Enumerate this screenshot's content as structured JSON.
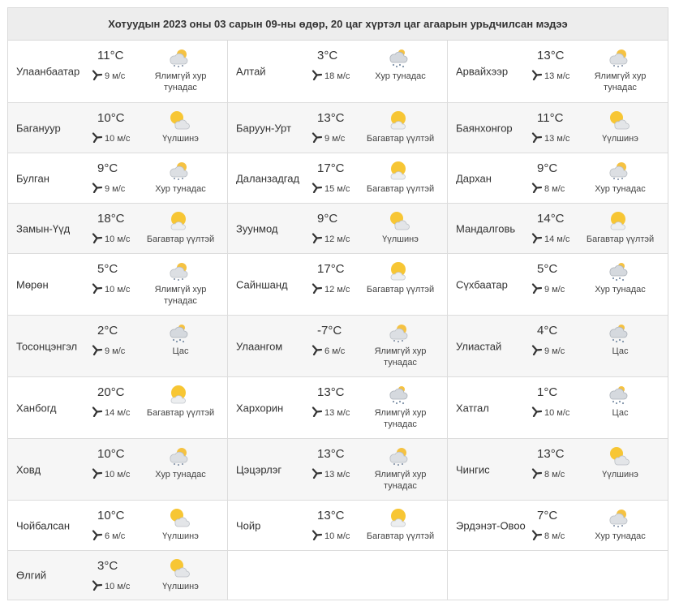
{
  "title": "Хотуудын 2023 оны 03 сарын 09-ны өдөр, 20 цаг хүртэл цаг агаарын урьдчилсан мэдээ",
  "unit": "°C",
  "rows": [
    [
      {
        "city": "Улаанбаатар",
        "temp": "11",
        "wind": "9 м/с",
        "desc": "Ялимгүй хур тунадас",
        "icon": "cloud-sun-snow-icon"
      },
      {
        "city": "Алтай",
        "temp": "3",
        "wind": "18 м/с",
        "desc": "Хур тунадас",
        "icon": "cloud-snow-icon"
      },
      {
        "city": "Арвайхээр",
        "temp": "13",
        "wind": "13 м/с",
        "desc": "Ялимгүй хур тунадас",
        "icon": "cloud-sun-snow-icon"
      }
    ],
    [
      {
        "city": "Багануур",
        "temp": "10",
        "wind": "10 м/с",
        "desc": "Үүлшинэ",
        "icon": "sun-cloud-icon"
      },
      {
        "city": "Баруун-Урт",
        "temp": "13",
        "wind": "9 м/с",
        "desc": "Багавтар үүлтэй",
        "icon": "sun-small-cloud-icon"
      },
      {
        "city": "Баянхонгор",
        "temp": "11",
        "wind": "13 м/с",
        "desc": "Үүлшинэ",
        "icon": "sun-cloud-icon"
      }
    ],
    [
      {
        "city": "Булган",
        "temp": "9",
        "wind": "9 м/с",
        "desc": "Хур тунадас",
        "icon": "cloud-sun-snow-icon"
      },
      {
        "city": "Даланзадгад",
        "temp": "17",
        "wind": "15 м/с",
        "desc": "Багавтар үүлтэй",
        "icon": "sun-small-cloud-icon"
      },
      {
        "city": "Дархан",
        "temp": "9",
        "wind": "8 м/с",
        "desc": "Хур тунадас",
        "icon": "cloud-sun-snow-icon"
      }
    ],
    [
      {
        "city": "Замын-Үүд",
        "temp": "18",
        "wind": "10 м/с",
        "desc": "Багавтар үүлтэй",
        "icon": "sun-small-cloud-icon"
      },
      {
        "city": "Зуунмод",
        "temp": "9",
        "wind": "12 м/с",
        "desc": "Үүлшинэ",
        "icon": "sun-cloud-icon"
      },
      {
        "city": "Мандалговь",
        "temp": "14",
        "wind": "14 м/с",
        "desc": "Багавтар үүлтэй",
        "icon": "sun-small-cloud-icon"
      }
    ],
    [
      {
        "city": "Мөрөн",
        "temp": "5",
        "wind": "10 м/с",
        "desc": "Ялимгүй хур тунадас",
        "icon": "cloud-sun-snow-icon"
      },
      {
        "city": "Сайншанд",
        "temp": "17",
        "wind": "12 м/с",
        "desc": "Багавтар үүлтэй",
        "icon": "sun-small-cloud-icon"
      },
      {
        "city": "Сүхбаатар",
        "temp": "5",
        "wind": "9 м/с",
        "desc": "Хур тунадас",
        "icon": "cloud-snow-icon"
      }
    ],
    [
      {
        "city": "Тосонцэнгэл",
        "temp": "2",
        "wind": "9 м/с",
        "desc": "Цас",
        "icon": "cloud-snow-icon"
      },
      {
        "city": "Улаангом",
        "temp": "-7",
        "wind": "6 м/с",
        "desc": "Ялимгүй хур тунадас",
        "icon": "cloud-sun-snow-icon"
      },
      {
        "city": "Улиастай",
        "temp": "4",
        "wind": "9 м/с",
        "desc": "Цас",
        "icon": "cloud-snow-icon"
      }
    ],
    [
      {
        "city": "Ханбогд",
        "temp": "20",
        "wind": "14 м/с",
        "desc": "Багавтар үүлтэй",
        "icon": "sun-small-cloud-icon"
      },
      {
        "city": "Хархорин",
        "temp": "13",
        "wind": "13 м/с",
        "desc": "Ялимгүй хур тунадас",
        "icon": "cloud-snow-icon"
      },
      {
        "city": "Хатгал",
        "temp": "1",
        "wind": "10 м/с",
        "desc": "Цас",
        "icon": "cloud-snow-icon"
      }
    ],
    [
      {
        "city": "Ховд",
        "temp": "10",
        "wind": "10 м/с",
        "desc": "Хур тунадас",
        "icon": "cloud-sun-snow-icon"
      },
      {
        "city": "Цэцэрлэг",
        "temp": "13",
        "wind": "13 м/с",
        "desc": "Ялимгүй хур тунадас",
        "icon": "cloud-sun-snow-icon"
      },
      {
        "city": "Чингис",
        "temp": "13",
        "wind": "8 м/с",
        "desc": "Үүлшинэ",
        "icon": "sun-cloud-icon"
      }
    ],
    [
      {
        "city": "Чойбалсан",
        "temp": "10",
        "wind": "6 м/с",
        "desc": "Үүлшинэ",
        "icon": "sun-cloud-icon"
      },
      {
        "city": "Чойр",
        "temp": "13",
        "wind": "10 м/с",
        "desc": "Багавтар үүлтэй",
        "icon": "sun-small-cloud-icon"
      },
      {
        "city": "Эрдэнэт-Овоо",
        "temp": "7",
        "wind": "8 м/с",
        "desc": "Хур тунадас",
        "icon": "cloud-sun-snow-icon"
      }
    ],
    [
      {
        "city": "Өлгий",
        "temp": "3",
        "wind": "10 м/с",
        "desc": "Үүлшинэ",
        "icon": "sun-cloud-icon"
      }
    ]
  ]
}
